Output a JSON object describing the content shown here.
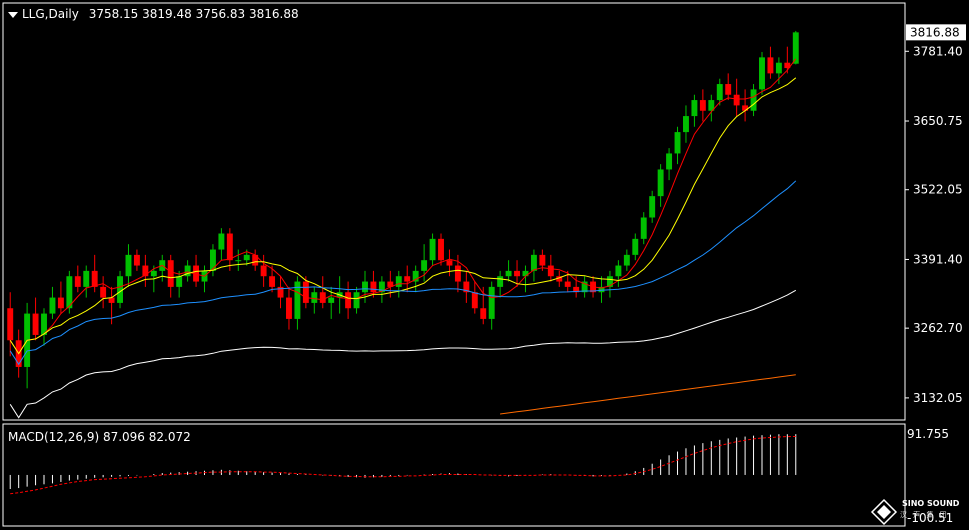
{
  "header": {
    "symbol_timeframe": "LLG,Daily",
    "ohlc": "3758.15 3819.48 3756.83 3816.88"
  },
  "macd": {
    "label": "MACD(12,26,9) 87.096 82.072",
    "axis_top": "91.755",
    "axis_bottom": "-100.51"
  },
  "price_axis": {
    "current_price": "3816.88",
    "ticks": [
      "3781.40",
      "3650.75",
      "3522.05",
      "3391.40",
      "3262.70",
      "3132.05"
    ]
  },
  "watermark": {
    "brand": "SINO SOUND",
    "sub": "汉 声 集 团"
  },
  "colors": {
    "background": "#000000",
    "bull_candle": "#00c000",
    "bear_candle": "#ff0000",
    "ma_fast": "#ffff00",
    "ma_mid": "#1e90ff",
    "ma_slow": "#ffffff",
    "ma_long": "#ff6a00",
    "ma_short_red": "#ff0000",
    "macd_histogram": "#ffffff",
    "macd_signal": "#ff0000",
    "price_tag_bg": "#ffffff",
    "price_tag_text": "#000000"
  },
  "chart_data": {
    "type": "candlestick",
    "title": "LLG,Daily",
    "ylim": [
      3100,
      3840
    ],
    "candles": [
      [
        3300,
        3330,
        3210,
        3240
      ],
      [
        3240,
        3260,
        3170,
        3190
      ],
      [
        3190,
        3310,
        3150,
        3290
      ],
      [
        3290,
        3320,
        3240,
        3250
      ],
      [
        3250,
        3300,
        3230,
        3290
      ],
      [
        3290,
        3340,
        3280,
        3320
      ],
      [
        3320,
        3350,
        3290,
        3300
      ],
      [
        3300,
        3370,
        3290,
        3360
      ],
      [
        3360,
        3380,
        3330,
        3340
      ],
      [
        3340,
        3380,
        3320,
        3370
      ],
      [
        3370,
        3400,
        3330,
        3340
      ],
      [
        3340,
        3360,
        3300,
        3320
      ],
      [
        3320,
        3340,
        3270,
        3310
      ],
      [
        3310,
        3370,
        3300,
        3360
      ],
      [
        3360,
        3420,
        3340,
        3400
      ],
      [
        3400,
        3410,
        3370,
        3380
      ],
      [
        3380,
        3400,
        3340,
        3360
      ],
      [
        3360,
        3380,
        3330,
        3370
      ],
      [
        3370,
        3400,
        3350,
        3390
      ],
      [
        3390,
        3400,
        3320,
        3340
      ],
      [
        3340,
        3370,
        3320,
        3360
      ],
      [
        3360,
        3390,
        3350,
        3380
      ],
      [
        3380,
        3400,
        3340,
        3350
      ],
      [
        3350,
        3380,
        3330,
        3370
      ],
      [
        3370,
        3420,
        3360,
        3410
      ],
      [
        3410,
        3450,
        3390,
        3440
      ],
      [
        3440,
        3450,
        3370,
        3390
      ],
      [
        3390,
        3410,
        3370,
        3390
      ],
      [
        3390,
        3410,
        3380,
        3400
      ],
      [
        3400,
        3410,
        3370,
        3380
      ],
      [
        3380,
        3400,
        3340,
        3360
      ],
      [
        3360,
        3380,
        3330,
        3340
      ],
      [
        3340,
        3360,
        3300,
        3320
      ],
      [
        3320,
        3340,
        3260,
        3280
      ],
      [
        3280,
        3360,
        3260,
        3350
      ],
      [
        3350,
        3360,
        3300,
        3310
      ],
      [
        3310,
        3340,
        3290,
        3330
      ],
      [
        3330,
        3360,
        3300,
        3310
      ],
      [
        3310,
        3340,
        3280,
        3320
      ],
      [
        3320,
        3360,
        3290,
        3330
      ],
      [
        3330,
        3350,
        3280,
        3300
      ],
      [
        3300,
        3340,
        3290,
        3330
      ],
      [
        3330,
        3370,
        3310,
        3350
      ],
      [
        3350,
        3370,
        3320,
        3330
      ],
      [
        3330,
        3360,
        3310,
        3350
      ],
      [
        3350,
        3370,
        3320,
        3340
      ],
      [
        3340,
        3370,
        3320,
        3360
      ],
      [
        3360,
        3380,
        3330,
        3350
      ],
      [
        3350,
        3380,
        3330,
        3370
      ],
      [
        3370,
        3420,
        3350,
        3390
      ],
      [
        3390,
        3440,
        3380,
        3430
      ],
      [
        3430,
        3440,
        3380,
        3390
      ],
      [
        3390,
        3410,
        3360,
        3380
      ],
      [
        3380,
        3400,
        3330,
        3350
      ],
      [
        3350,
        3370,
        3310,
        3330
      ],
      [
        3330,
        3350,
        3290,
        3300
      ],
      [
        3300,
        3340,
        3270,
        3280
      ],
      [
        3280,
        3350,
        3260,
        3340
      ],
      [
        3340,
        3370,
        3320,
        3360
      ],
      [
        3360,
        3390,
        3350,
        3370
      ],
      [
        3370,
        3390,
        3340,
        3360
      ],
      [
        3360,
        3380,
        3330,
        3370
      ],
      [
        3370,
        3410,
        3350,
        3400
      ],
      [
        3400,
        3410,
        3370,
        3380
      ],
      [
        3380,
        3400,
        3350,
        3360
      ],
      [
        3360,
        3370,
        3340,
        3350
      ],
      [
        3350,
        3370,
        3330,
        3340
      ],
      [
        3340,
        3360,
        3320,
        3330
      ],
      [
        3330,
        3360,
        3320,
        3350
      ],
      [
        3350,
        3360,
        3320,
        3330
      ],
      [
        3330,
        3360,
        3310,
        3340
      ],
      [
        3340,
        3370,
        3320,
        3360
      ],
      [
        3360,
        3390,
        3340,
        3380
      ],
      [
        3380,
        3410,
        3370,
        3400
      ],
      [
        3400,
        3440,
        3390,
        3430
      ],
      [
        3430,
        3480,
        3420,
        3470
      ],
      [
        3470,
        3520,
        3460,
        3510
      ],
      [
        3510,
        3570,
        3490,
        3560
      ],
      [
        3560,
        3600,
        3540,
        3590
      ],
      [
        3590,
        3640,
        3570,
        3630
      ],
      [
        3630,
        3680,
        3610,
        3660
      ],
      [
        3660,
        3700,
        3640,
        3690
      ],
      [
        3690,
        3710,
        3650,
        3670
      ],
      [
        3670,
        3700,
        3650,
        3690
      ],
      [
        3690,
        3730,
        3680,
        3720
      ],
      [
        3720,
        3740,
        3690,
        3700
      ],
      [
        3700,
        3730,
        3660,
        3680
      ],
      [
        3680,
        3710,
        3650,
        3670
      ],
      [
        3670,
        3720,
        3660,
        3710
      ],
      [
        3710,
        3780,
        3700,
        3770
      ],
      [
        3770,
        3790,
        3730,
        3740
      ],
      [
        3740,
        3770,
        3720,
        3760
      ],
      [
        3760,
        3790,
        3740,
        3750
      ],
      [
        3758.15,
        3819.48,
        3756.83,
        3816.88
      ]
    ],
    "macd_histogram": [
      -30,
      -28,
      -25,
      -22,
      -20,
      -18,
      -15,
      -12,
      -10,
      -8,
      -6,
      -5,
      -4,
      -3,
      -2,
      -1,
      0,
      2,
      4,
      5,
      6,
      7,
      8,
      9,
      10,
      11,
      10,
      9,
      8,
      7,
      6,
      5,
      4,
      3,
      2,
      1,
      0,
      -1,
      -2,
      -3,
      -4,
      -5,
      -6,
      -5,
      -4,
      -3,
      -2,
      -1,
      0,
      1,
      2,
      3,
      4,
      3,
      2,
      1,
      0,
      -1,
      -2,
      -3,
      -2,
      -1,
      0,
      1,
      2,
      1,
      0,
      -1,
      -2,
      -3,
      -2,
      -1,
      0,
      3,
      8,
      15,
      24,
      33,
      42,
      50,
      57,
      63,
      68,
      72,
      75,
      78,
      80,
      82,
      84,
      85,
      86,
      87,
      87,
      87.096
    ],
    "macd_signal": [
      -40,
      -38,
      -35,
      -32,
      -28,
      -24,
      -20,
      -17,
      -14,
      -12,
      -10,
      -9,
      -8,
      -7,
      -6,
      -5,
      -4,
      -2,
      0,
      1,
      2,
      3,
      4,
      5,
      6,
      6,
      7,
      7,
      7,
      7,
      6,
      6,
      5,
      4,
      3,
      2,
      1,
      0,
      -1,
      -2,
      -3,
      -3,
      -4,
      -4,
      -4,
      -3,
      -3,
      -2,
      -2,
      -1,
      0,
      1,
      1,
      1,
      1,
      1,
      0,
      0,
      -1,
      -1,
      -1,
      -1,
      -1,
      0,
      0,
      0,
      0,
      -1,
      -1,
      -2,
      -2,
      -2,
      -1,
      0,
      3,
      7,
      12,
      18,
      25,
      32,
      39,
      46,
      52,
      58,
      63,
      67,
      71,
      74,
      77,
      79,
      80,
      81,
      82,
      82.072
    ],
    "macd_ylim": [
      -100.51,
      91.755
    ]
  }
}
